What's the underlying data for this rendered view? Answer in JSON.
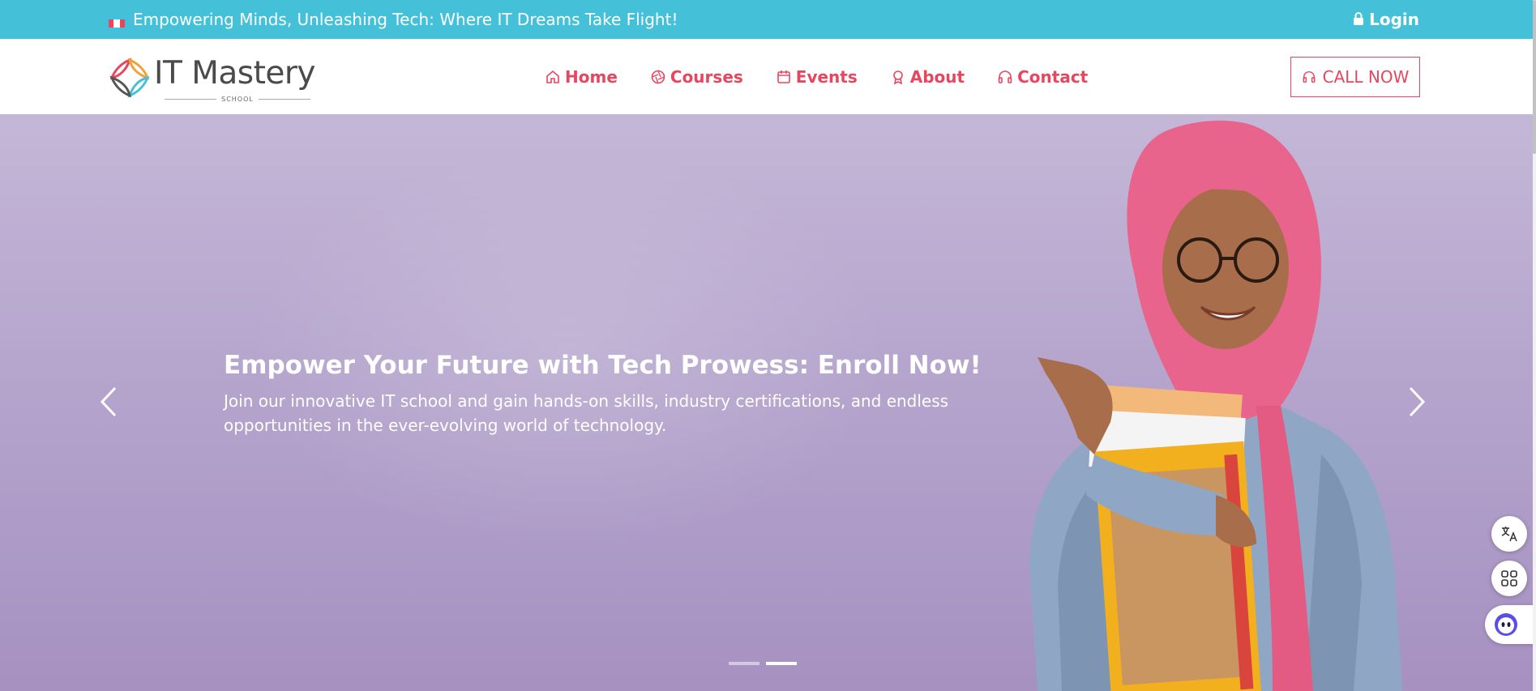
{
  "topbar": {
    "message": "Empowering Minds, Unleashing Tech: Where IT Dreams Take Flight!",
    "flag_icon": "megaphone-icon",
    "login_label": "Login",
    "login_icon": "lock-icon",
    "background": "#44c1d9"
  },
  "header": {
    "logo": {
      "title": "IT Mastery",
      "subtitle": "SCHOOL"
    },
    "nav": [
      {
        "label": "Home",
        "icon": "home-icon"
      },
      {
        "label": "Courses",
        "icon": "aperture-icon"
      },
      {
        "label": "Events",
        "icon": "calendar-icon"
      },
      {
        "label": "About",
        "icon": "award-icon"
      },
      {
        "label": "Contact",
        "icon": "headphones-icon"
      }
    ],
    "call_label": "CALL NOW",
    "call_icon": "headphones-icon",
    "accent": "#e8465e"
  },
  "hero": {
    "title": "Empower Your Future with Tech Prowess: Enroll Now!",
    "description": "Join our innovative IT school and gain hands-on skills, industry certifications, and endless opportunities in the ever-evolving world of technology.",
    "prev_icon": "chevron-left-icon",
    "next_icon": "chevron-right-icon",
    "slide_count": 2,
    "active_slide": 2
  },
  "widgets": [
    {
      "icon": "translate-icon"
    },
    {
      "icon": "apps-grid-icon"
    },
    {
      "icon": "assistant-icon"
    }
  ]
}
